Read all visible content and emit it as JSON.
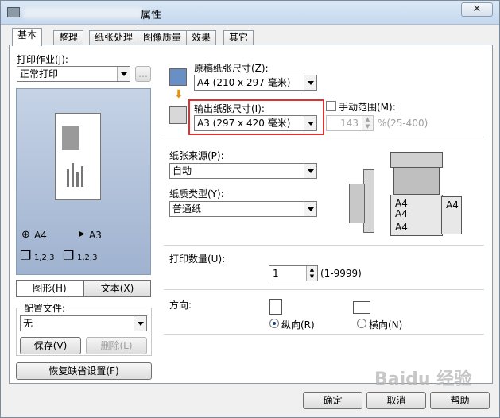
{
  "window": {
    "title": "属性",
    "close_label": "✕"
  },
  "tabs": [
    "基本",
    "整理",
    "纸张处理",
    "图像质量",
    "效果",
    "其它"
  ],
  "left": {
    "print_job_label": "打印作业(J):",
    "print_job_value": "正常打印",
    "more_button": "…",
    "preview": {
      "orig_size": "A4",
      "out_size": "A3",
      "pages_a": "1,2,3",
      "pages_b": "1,2,3"
    },
    "view_tabs": [
      "图形(H)",
      "文本(X)"
    ],
    "config_label": "配置文件:",
    "config_value": "无",
    "save_button": "保存(V)",
    "delete_button": "删除(L)",
    "restore_button": "恢复缺省设置(F)"
  },
  "right": {
    "original_size_label": "原稿纸张尺寸(Z):",
    "original_size_value": "A4 (210 x 297 毫米)",
    "output_size_label": "输出纸张尺寸(I):",
    "output_size_value": "A3 (297 x 420 毫米)",
    "manual_range_label": "手动范围(M):",
    "zoom_value": "143",
    "zoom_range": "%(25-400)",
    "paper_source_label": "纸张来源(P):",
    "paper_source_value": "自动",
    "paper_type_label": "纸质类型(Y):",
    "paper_type_value": "普通纸",
    "tray_labels": [
      "A4",
      "A4",
      "A4",
      "A4"
    ],
    "copies_label": "打印数量(U):",
    "copies_value": "1",
    "copies_range": "(1-9999)",
    "orientation_label": "方向:",
    "portrait_label": "纵向(R)",
    "landscape_label": "横向(N)"
  },
  "footer": {
    "ok": "确定",
    "cancel": "取消",
    "help": "帮助"
  },
  "watermark": "Baidu 经验"
}
